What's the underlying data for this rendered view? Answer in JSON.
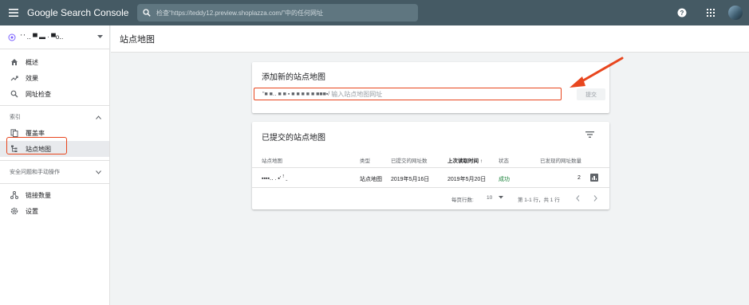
{
  "topbar": {
    "logo": "Google Search Console",
    "search_placeholder": "检查“https://teddy12.preview.shoplazza.com/”中的任何网址"
  },
  "sidebar": {
    "property_name": "' ' ‥ ▀ ▬ ·  ▀o‥",
    "items": [
      {
        "label": "概述",
        "icon": "home-icon"
      },
      {
        "label": "效果",
        "icon": "trending-up-icon"
      },
      {
        "label": "网址检查",
        "icon": "search-icon"
      }
    ],
    "section_index": "索引",
    "index_items": [
      {
        "label": "覆盖率",
        "icon": "copy-icon"
      },
      {
        "label": "站点地图",
        "icon": "sitemap-icon"
      }
    ],
    "section_security": "安全问题和手动操作",
    "bottom_items": [
      {
        "label": "链接数量",
        "icon": "links-icon"
      },
      {
        "label": "设置",
        "icon": "gear-icon"
      }
    ]
  },
  "header": {
    "title": "站点地图"
  },
  "add_card": {
    "title": "添加新的站点地图",
    "url_prefix": "\"■ ■‥ ■ ■  ▪    ■ ■ ■ ■ ■   ■■■▪/",
    "input_placeholder": "输入站点地图网址",
    "submit_label": "提交"
  },
  "submitted_card": {
    "title": "已提交的站点地图",
    "columns": [
      "站点地图",
      "类型",
      "已提交的网址数",
      "上次读取时间",
      "状态",
      "已发现的网址数量"
    ],
    "sort_arrow": "↑",
    "rows": [
      {
        "sitemap": "▪▪▪▪‥ . ▪' ꜝ ˍ",
        "type": "站点地图",
        "submitted": "2019年5月16日",
        "last_read": "2019年5月20日",
        "status": "成功",
        "discovered": "2"
      }
    ],
    "rows_per_page_label": "每页行数:",
    "rows_per_page_value": "10",
    "range_text": "第 1-1 行，共 1 行"
  },
  "colors": {
    "topbar": "#455a64",
    "highlight": "#e8461e",
    "success": "#188038"
  }
}
